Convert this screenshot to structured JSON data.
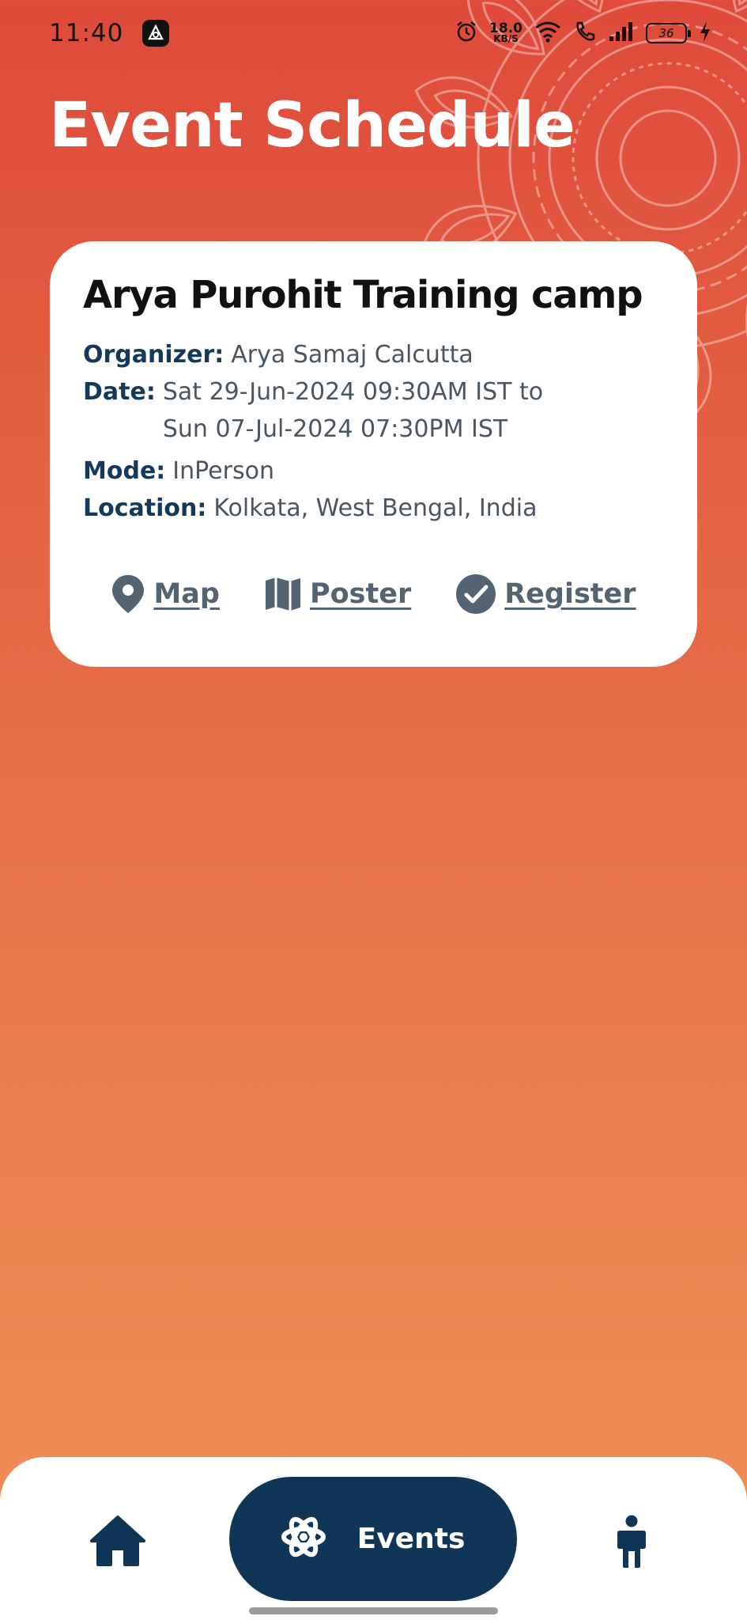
{
  "status_bar": {
    "time": "11:40",
    "net_speed_value": "18.0",
    "net_speed_unit": "KB/S",
    "battery": "36",
    "icons": [
      "app-notification-icon",
      "alarm-icon",
      "wifi-icon",
      "wifi-call-icon",
      "signal-icon",
      "battery-icon",
      "charging-icon"
    ]
  },
  "header": {
    "title": "Event Schedule"
  },
  "event": {
    "title": "Arya Purohit Training camp",
    "organizer_label": "Organizer:",
    "organizer": "Arya Samaj Calcutta",
    "date_label": "Date:",
    "date_line1": "Sat 29-Jun-2024 09:30AM IST to",
    "date_line2": "Sun 07-Jul-2024 07:30PM IST",
    "mode_label": "Mode:",
    "mode": "InPerson",
    "location_label": "Location:",
    "location": "Kolkata, West Bengal, India",
    "actions": {
      "map": "Map",
      "poster": "Poster",
      "register": "Register"
    }
  },
  "bottom_nav": {
    "events_label": "Events",
    "icons": [
      "home-icon",
      "atom-icon",
      "person-icon"
    ]
  },
  "colors": {
    "background_top": "#df4a3a",
    "background_bottom": "#ef9056",
    "navy": "#0f3557",
    "action_gray": "#546371"
  }
}
